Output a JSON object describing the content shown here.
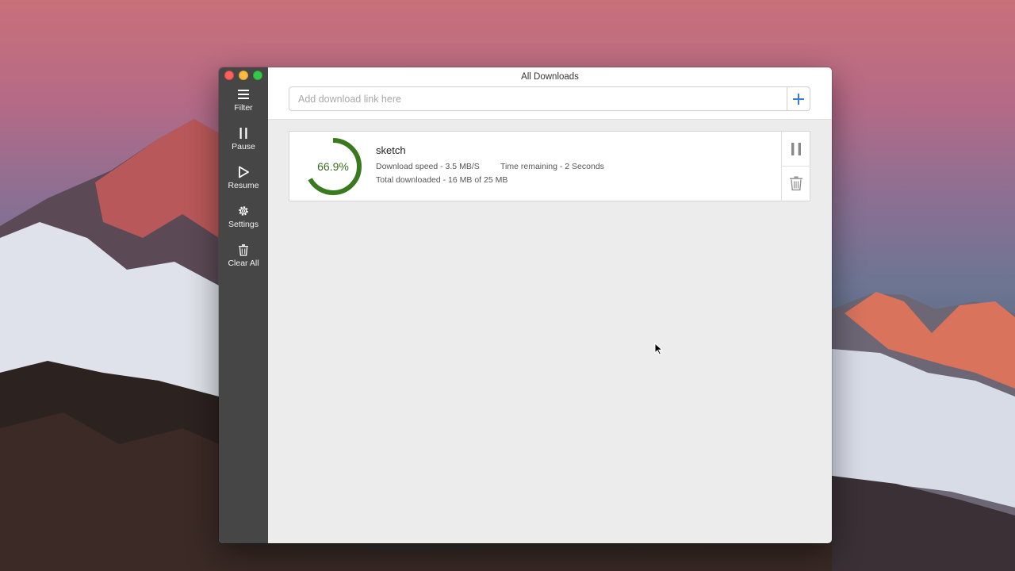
{
  "window": {
    "title": "All Downloads"
  },
  "sidebar": {
    "items": [
      {
        "label": "Filter",
        "icon": "hamburger-icon"
      },
      {
        "label": "Pause",
        "icon": "pause-icon"
      },
      {
        "label": "Resume",
        "icon": "play-icon"
      },
      {
        "label": "Settings",
        "icon": "gear-icon"
      },
      {
        "label": "Clear All",
        "icon": "trash-icon"
      }
    ]
  },
  "url_bar": {
    "placeholder": "Add download link here",
    "value": ""
  },
  "downloads": [
    {
      "name": "sketch",
      "progress_label": "66.9%",
      "progress": 0.669,
      "speed": "Download speed - 3.5 MB/S",
      "time_remaining": "Time remaining - 2 Seconds",
      "total": "Total downloaded - 16 MB of 25 MB"
    }
  ],
  "colors": {
    "sidebar_bg": "#464646",
    "progress": "#3a7a1e",
    "accent": "#3a7bd5"
  }
}
